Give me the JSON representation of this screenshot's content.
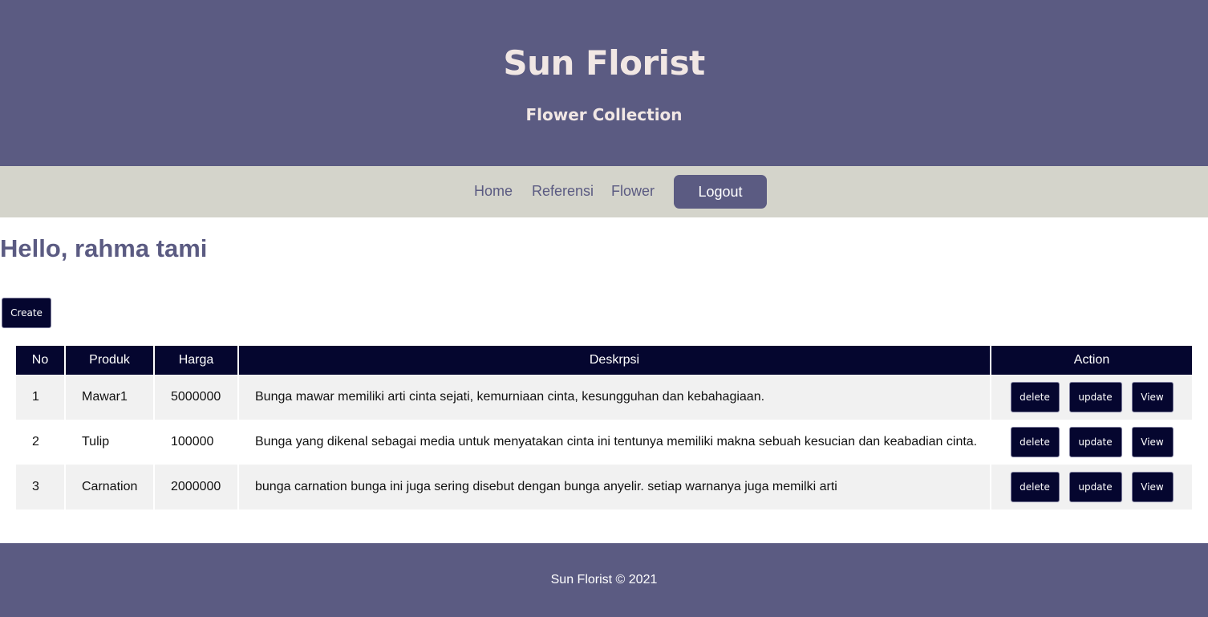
{
  "header": {
    "title": "Sun Florist",
    "subtitle": "Flower Collection"
  },
  "nav": {
    "items": [
      "Home",
      "Referensi",
      "Flower"
    ],
    "logout_label": "Logout"
  },
  "greeting": "Hello, rahma tami",
  "create_label": "Create",
  "table": {
    "columns": [
      "No",
      "Produk",
      "Harga",
      "Deskrpsi",
      "Action"
    ],
    "rows": [
      {
        "no": "1",
        "produk": "Mawar1",
        "harga": "5000000",
        "deskripsi": "Bunga mawar memiliki arti cinta sejati, kemurniaan cinta, kesungguhan dan kebahagiaan."
      },
      {
        "no": "2",
        "produk": "Tulip",
        "harga": "100000",
        "deskripsi": "Bunga yang dikenal sebagai media untuk menyatakan cinta ini tentunya memiliki makna sebuah kesucian dan keabadian cinta."
      },
      {
        "no": "3",
        "produk": "Carnation",
        "harga": "2000000",
        "deskripsi": "bunga carnation bunga ini juga sering disebut dengan bunga anyelir. setiap warnanya juga memilki arti"
      }
    ],
    "actions": {
      "delete": "delete",
      "update": "update",
      "view": "View"
    }
  },
  "footer": {
    "text": "Sun Florist © 2021"
  },
  "colors": {
    "brand": "#5b5b82",
    "nav_bg": "#d4d4cb",
    "button_dark": "#05062f",
    "title_text": "#f1e7e4"
  }
}
